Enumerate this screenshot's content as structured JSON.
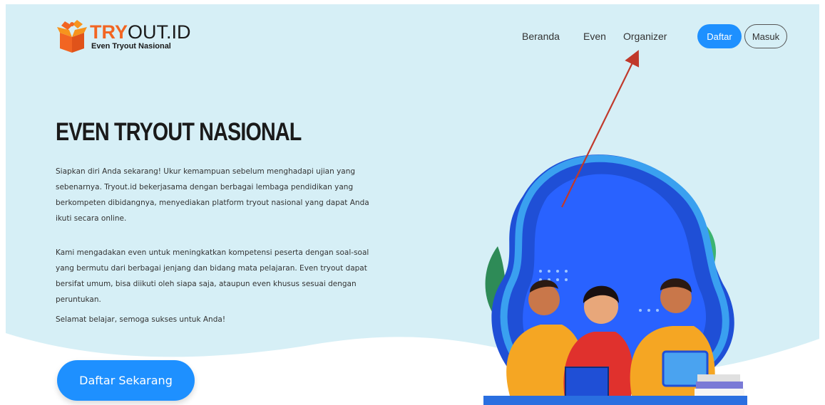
{
  "logo": {
    "brand_try": "TRY",
    "brand_rest": "OUT.ID",
    "tagline": "Even Tryout Nasional"
  },
  "nav": {
    "items": [
      "Beranda",
      "Even",
      "Organizer"
    ]
  },
  "auth": {
    "register_label": "Daftar",
    "login_label": "Masuk"
  },
  "hero": {
    "title": "EVEN TRYOUT NASIONAL",
    "paragraphs": [
      "Siapkan diri Anda sekarang! Ukur kemampuan sebelum menghadapi ujian yang sebenarnya. Tryout.id bekerjasama dengan berbagai lembaga pendidikan yang berkompeten dibidangnya, menyediakan platform tryout nasional yang dapat Anda ikuti secara online.",
      "Kami mengadakan even untuk meningkatkan kompetensi peserta dengan soal-soal yang bermutu dari berbagai jenjang dan bidang mata pelajaran. Even tryout dapat bersifat umum, bisa diikuti oleh siapa saja, ataupun even khusus sesuai dengan peruntukan.",
      "Selamat belajar, semoga sukses untuk Anda!"
    ],
    "cta_label": "Daftar Sekarang"
  },
  "colors": {
    "primary": "#1e90ff",
    "brand_orange": "#f26522",
    "hero_bg": "#d6eff6",
    "arrow": "#c0392b"
  },
  "icons": {
    "logo": "open-box-icon",
    "annotation": "red-arrow-icon"
  }
}
